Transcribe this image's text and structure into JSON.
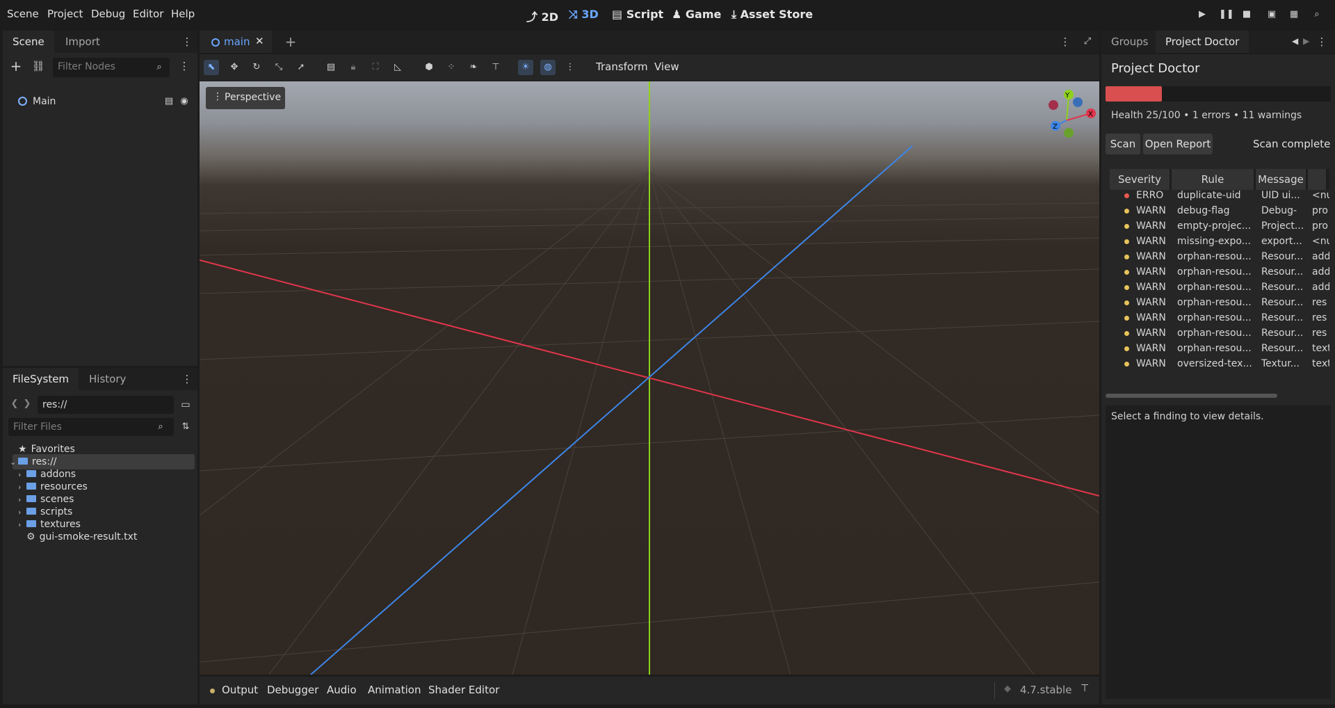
{
  "menubar": {
    "items": [
      "Scene",
      "Project",
      "Debug",
      "Editor",
      "Help"
    ],
    "workspaces": [
      "2D",
      "3D",
      "Script",
      "Game",
      "Asset Store"
    ],
    "active_workspace": "3D"
  },
  "scene_dock": {
    "tabs": [
      "Scene",
      "Import"
    ],
    "filter_placeholder": "Filter Nodes",
    "root_node": "Main"
  },
  "filesystem_dock": {
    "tabs": [
      "FileSystem",
      "History"
    ],
    "path": "res://",
    "filter_placeholder": "Filter Files",
    "favorites_label": "Favorites",
    "root_label": "res://",
    "folders": [
      "addons",
      "resources",
      "scenes",
      "scripts",
      "textures"
    ],
    "files": [
      "gui-smoke-result.txt"
    ]
  },
  "editor": {
    "scene_tab": "main",
    "menus": [
      "Transform",
      "View"
    ],
    "viewport_label": "Perspective",
    "gizmo_axes": [
      "Y",
      "X",
      "Z"
    ]
  },
  "bottom_panel": {
    "tabs": [
      "Output",
      "Debugger",
      "Audio",
      "Animation",
      "Shader Editor"
    ],
    "version": "4.7.stable"
  },
  "right_dock": {
    "tabs": [
      "Groups",
      "Project Doctor"
    ],
    "title": "Project Doctor",
    "health_fraction": 0.25,
    "health_color": "#d94f4f",
    "summary": "Health 25/100 • 1 errors • 11 warnings",
    "scan_button": "Scan",
    "report_button": "Open Report",
    "status": "Scan complete",
    "columns": [
      "Severity",
      "Rule",
      "Message"
    ],
    "findings": [
      {
        "severity": "ERRO",
        "rule": "duplicate-uid",
        "message": "UID ui...",
        "extra": "<nu"
      },
      {
        "severity": "WARN",
        "rule": "debug-flag",
        "message": "Debug-",
        "extra": "pro"
      },
      {
        "severity": "WARN",
        "rule": "empty-projec...",
        "message": "Project...",
        "extra": "pro"
      },
      {
        "severity": "WARN",
        "rule": "missing-expo...",
        "message": "export...",
        "extra": "<nu"
      },
      {
        "severity": "WARN",
        "rule": "orphan-resou...",
        "message": "Resour...",
        "extra": "add"
      },
      {
        "severity": "WARN",
        "rule": "orphan-resou...",
        "message": "Resour...",
        "extra": "add"
      },
      {
        "severity": "WARN",
        "rule": "orphan-resou...",
        "message": "Resour...",
        "extra": "add"
      },
      {
        "severity": "WARN",
        "rule": "orphan-resou...",
        "message": "Resour...",
        "extra": "res"
      },
      {
        "severity": "WARN",
        "rule": "orphan-resou...",
        "message": "Resour...",
        "extra": "res"
      },
      {
        "severity": "WARN",
        "rule": "orphan-resou...",
        "message": "Resour...",
        "extra": "res"
      },
      {
        "severity": "WARN",
        "rule": "orphan-resou...",
        "message": "Resour...",
        "extra": "text"
      },
      {
        "severity": "WARN",
        "rule": "oversized-tex...",
        "message": "Textur...",
        "extra": "text"
      }
    ],
    "details_placeholder": "Select a finding to view details."
  }
}
